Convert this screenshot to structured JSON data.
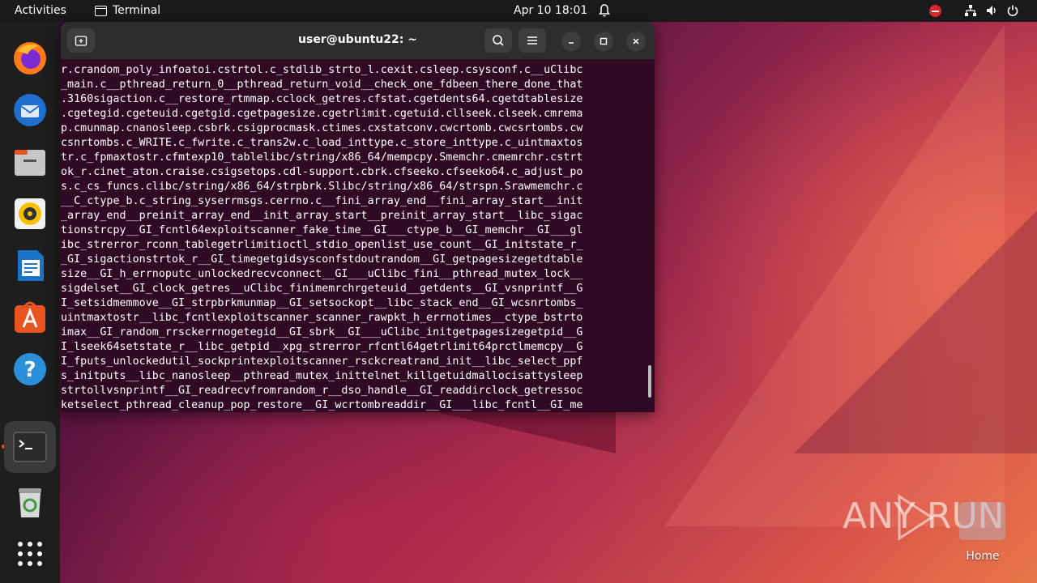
{
  "topbar": {
    "activities": "Activities",
    "app_name": "Terminal",
    "clock": "Apr 10  18:01"
  },
  "dock": {
    "items": [
      "firefox-icon",
      "thunderbird-icon",
      "files-icon",
      "rhythmbox-icon",
      "writer-icon",
      "app-center-icon",
      "help-icon",
      "terminal-icon",
      "trash-icon",
      "show-apps-icon"
    ]
  },
  "terminal": {
    "title": "user@ubuntu22: ~",
    "lines": [
      "r.crandom_poly_infoatoi.cstrtol.c_stdlib_strto_l.cexit.csleep.csysconf.c__uClibc",
      "_main.c__pthread_return_0__pthread_return_void__check_one_fdbeen_there_done_that",
      ".3160sigaction.c__restore_rtmmap.cclock_getres.cfstat.cgetdents64.cgetdtablesize",
      ".cgetegid.cgeteuid.cgetgid.cgetpagesize.cgetrlimit.cgetuid.cllseek.clseek.cmrema",
      "p.cmunmap.cnanosleep.csbrk.csigprocmask.ctimes.cxstatconv.cwcrtomb.cwcsrtombs.cw",
      "csnrtombs.c_WRITE.c_fwrite.c_trans2w.c_load_inttype.c_store_inttype.c_uintmaxtos",
      "tr.c_fpmaxtostr.cfmtexp10_tablelibc/string/x86_64/mempcpy.Smemchr.cmemrchr.cstrt",
      "ok_r.cinet_aton.craise.csigsetops.cdl-support.cbrk.cfseeko.cfseeko64.c_adjust_po",
      "s.c_cs_funcs.clibc/string/x86_64/strpbrk.Slibc/string/x86_64/strspn.Srawmemchr.c",
      "__C_ctype_b.c_string_syserrmsgs.cerrno.c__fini_array_end__fini_array_start__init",
      "_array_end__preinit_array_end__init_array_start__preinit_array_start__libc_sigac",
      "tionstrcpy__GI_fcntl64exploitscanner_fake_time__GI___ctype_b__GI_memchr__GI___gl",
      "ibc_strerror_rconn_tablegetrlimitioctl_stdio_openlist_use_count__GI_initstate_r_",
      "_GI_sigactionstrtok_r__GI_timegetgidsysconfstdoutrandom__GI_getpagesizegetdtable",
      "size__GI_h_errnoputc_unlockedrecvconnect__GI___uClibc_fini__pthread_mutex_lock__",
      "sigdelset__GI_clock_getres__uClibc_finimemrchrgeteuid__getdents__GI_vsnprintf__G",
      "I_setsidmemmove__GI_strpbrkmunmap__GI_setsockopt__libc_stack_end__GI_wcsnrtombs_",
      "uintmaxtostr__libc_fcntlexploitscanner_scanner_rawpkt_h_errnotimes__ctype_bstrto",
      "imax__GI_random_rrsckerrnogetegid__GI_sbrk__GI___uClibc_initgetpagesizegetpid__G",
      "I_lseek64setstate_r__libc_getpid__xpg_strerror_rfcntl64getrlimit64prctlmemcpy__G",
      "I_fputs_unlockedutil_sockprintexploitscanner_rsckcreatrand_init__libc_select_ppf",
      "s_initputs__libc_nanosleep__pthread_mutex_inittelnet_killgetuidmallocisattysleep",
      "strtollvsnprintf__GI_readrecvfromrandom_r__dso_handle__GI_readdirclock_getressoc",
      "ketselect_pthread_cleanup_pop_restore__GI_wcrtombreaddir__GI___libc_fcntl__GI_me"
    ]
  },
  "watermark": {
    "text": "ANY RUN"
  },
  "desktop": {
    "home_label": "Home"
  }
}
